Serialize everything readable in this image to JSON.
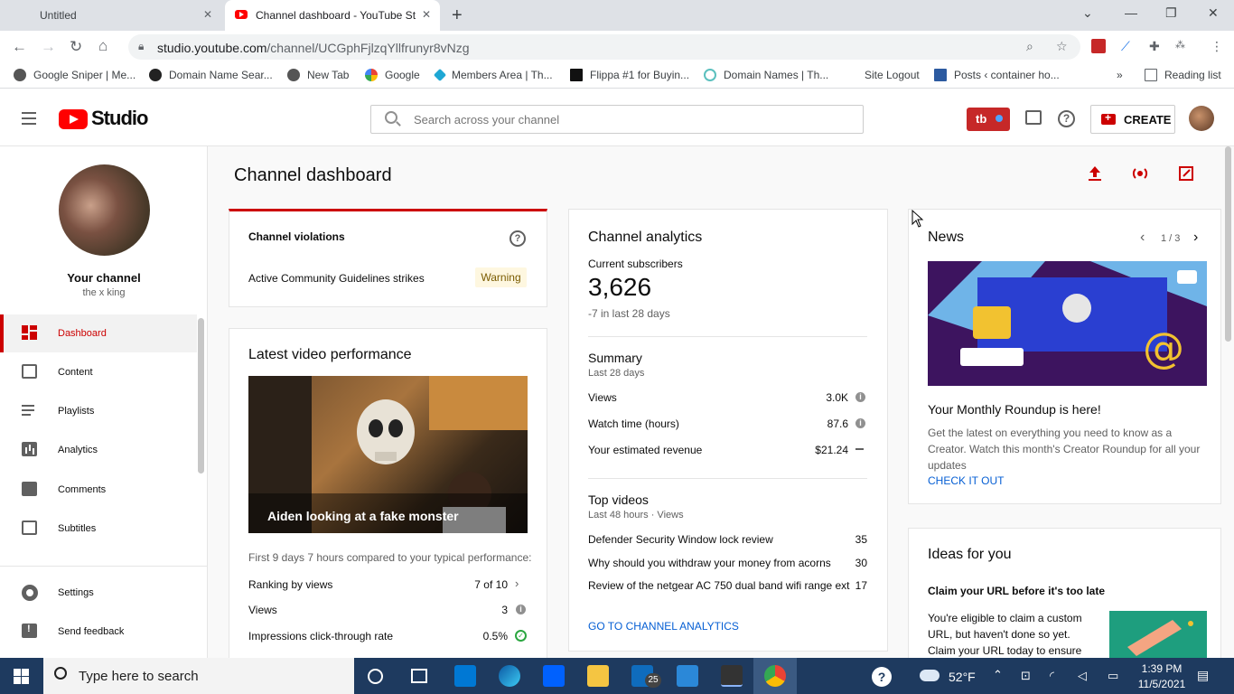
{
  "browser": {
    "tabs": [
      {
        "label": "Untitled",
        "active": false
      },
      {
        "label": "Channel dashboard - YouTube St",
        "active": true
      }
    ],
    "url_host": "studio.youtube.com",
    "url_path": "/channel/UCGphFjlzqYllfrunyr8vNzg",
    "bookmarks": [
      "Google Sniper | Me...",
      "Domain Name Sear...",
      "New Tab",
      "Google",
      "Members Area | Th...",
      "Flippa #1 for Buyin...",
      "Domain Names | Th...",
      "Site Logout",
      "Posts ‹ container ho..."
    ],
    "reading_list": "Reading list",
    "more_bookmarks": "»"
  },
  "header": {
    "logo_text": "Studio",
    "search_placeholder": "Search across your channel",
    "tb_badge": "tb",
    "create_label": "CREATE"
  },
  "sidebar": {
    "channel_label": "Your channel",
    "channel_handle": "the x king",
    "items": [
      {
        "label": "Dashboard",
        "active": true
      },
      {
        "label": "Content"
      },
      {
        "label": "Playlists"
      },
      {
        "label": "Analytics"
      },
      {
        "label": "Comments"
      },
      {
        "label": "Subtitles"
      }
    ],
    "bottom_items": [
      {
        "label": "Settings"
      },
      {
        "label": "Send feedback"
      }
    ]
  },
  "main": {
    "title": "Channel dashboard",
    "violations": {
      "title": "Channel violations",
      "row_label": "Active Community Guidelines strikes",
      "badge": "Warning"
    },
    "latest_video": {
      "title": "Latest video performance",
      "video_title": "Aiden looking at a fake monster",
      "compare_text": "First 9 days 7 hours compared to your typical performance:",
      "rows": [
        {
          "label": "Ranking by views",
          "value": "7 of 10"
        },
        {
          "label": "Views",
          "value": "3"
        },
        {
          "label": "Impressions click-through rate",
          "value": "0.5%"
        }
      ]
    },
    "analytics": {
      "title": "Channel analytics",
      "subs_label": "Current subscribers",
      "subs_value": "3,626",
      "subs_change": "-7 in last 28 days",
      "summary_title": "Summary",
      "summary_period": "Last 28 days",
      "summary_rows": [
        {
          "label": "Views",
          "value": "3.0K"
        },
        {
          "label": "Watch time (hours)",
          "value": "87.6"
        },
        {
          "label": "Your estimated revenue",
          "value": "$21.24"
        }
      ],
      "top_videos_title": "Top videos",
      "top_videos_period": "Last 48 hours · Views",
      "top_videos": [
        {
          "title": "Defender Security Window lock review",
          "views": "35"
        },
        {
          "title": "Why should you withdraw your money from acorns",
          "views": "30"
        },
        {
          "title": "Review of the netgear AC 750 dual band wifi range ext...",
          "views": "17"
        }
      ],
      "link": "GO TO CHANNEL ANALYTICS"
    },
    "news": {
      "title": "News",
      "pager": "1 / 3",
      "headline": "Your Monthly Roundup is here!",
      "body": "Get the latest on everything you need to know as a Creator. Watch this month's Creator Roundup for all your updates",
      "link": "CHECK IT OUT"
    },
    "ideas": {
      "title": "Ideas for you",
      "headline": "Claim your URL before it's too late",
      "body": "You're eligible to claim a custom URL, but haven't done so yet. Claim your URL today to ensure you get"
    }
  },
  "taskbar": {
    "search_placeholder": "Type here to search",
    "mail_badge": "25",
    "weather": "52°F",
    "time": "1:39 PM",
    "date": "11/5/2021"
  },
  "colors": {
    "accent_red": "#cc0000",
    "link_blue": "#065fd4",
    "warning_bg": "#fef7e0",
    "taskbar": "#1e3a5f"
  }
}
